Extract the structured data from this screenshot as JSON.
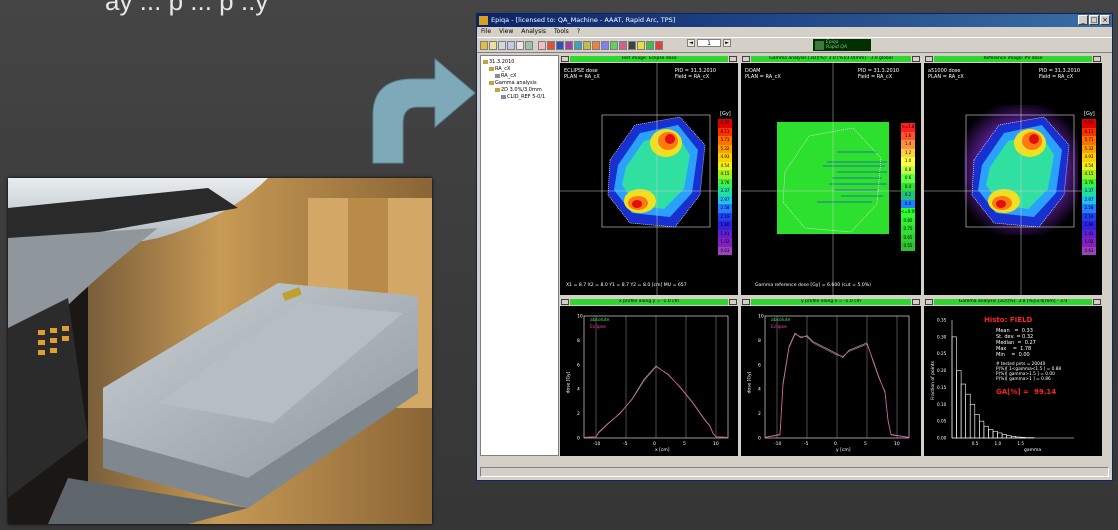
{
  "slide": {
    "caption": "ay  ... p ... p ..y"
  },
  "window": {
    "title": "Epiqa - [licensed to: QA_Machine - AAAT, Rapid Arc, TPS]",
    "menu": [
      "File",
      "View",
      "Analysis",
      "Tools",
      "?"
    ],
    "page_number": "1",
    "logo_line1": "Epiqa",
    "logo_line2": "Rapid QA"
  },
  "tree": {
    "items": [
      {
        "label": "31.3.2010",
        "depth": 0
      },
      {
        "label": "RA_cX",
        "depth": 1
      },
      {
        "label": "RA_cX",
        "depth": 2
      },
      {
        "label": "Gamma analysis",
        "depth": 1
      },
      {
        "label": "2D 3.0%/3.0mm",
        "depth": 2
      },
      {
        "label": "CLID_REF 5-0/1",
        "depth": 3
      }
    ]
  },
  "panels": {
    "test": {
      "title": "Test image: Eclipse dose",
      "left1": "ECLIPSE dose",
      "left2": "PLAN = RA_cX",
      "right1": "PID = 31.3.2010",
      "right2": "Field = RA_cX",
      "footer": "X1 = 8.7  X2 = 8.0  Y1 = 8.7  Y2 = 8.0  [cm]      MU = 657",
      "units": "[Gy]",
      "scale": [
        "6.50",
        "6.11",
        "5.71",
        "5.32",
        "4.93",
        "4.54",
        "4.15",
        "3.76",
        "3.37",
        "2.97",
        "2.58",
        "2.19",
        "1.80",
        "1.41",
        "1.02",
        "0.63"
      ]
    },
    "gamma": {
      "title": "Gamma analysis [3D](%): 3.0 [%]/3.0[mm] - 3.0 global",
      "left1": "DOAM",
      "left2": "PLAN = RA_cX",
      "right1": "PID = 31.3.2010",
      "right2": "Field = RA_cX",
      "footer": "Gamma reference dose [Gy] = 6.600 (cut = 5.0%)",
      "scale": [
        ">=1.8",
        "1.6",
        "1.4",
        "1.2",
        "1.0",
        "0.8",
        "0.6",
        "0.4",
        "0.2",
        "0.0",
        "<=0.95",
        "0.85",
        "0.75",
        "0.65",
        "0.55"
      ]
    },
    "reference": {
      "title": "Reference image: PV dose",
      "left1": "a51000 dose",
      "left2": "PLAN = RA_cX",
      "right1": "PID = 31.3.2010",
      "right2": "Field = RA_cX",
      "units": "[Gy]",
      "scale": [
        "6.50",
        "6.11",
        "5.71",
        "5.32",
        "4.93",
        "4.54",
        "4.15",
        "3.76",
        "3.37",
        "2.97",
        "2.58",
        "2.19",
        "1.80",
        "1.41",
        "1.02",
        "0.63"
      ]
    },
    "xprofile": {
      "title": "x profile along y = -1.0 cm",
      "legend1": "absolute",
      "legend2": "Eclipse",
      "xlabel": "x [cm]",
      "ylabel": "dose [Gy]",
      "xticks": [
        "-10",
        "-5",
        "0",
        "5",
        "10"
      ],
      "yticks": [
        "0",
        "2",
        "4",
        "6",
        "8",
        "10"
      ]
    },
    "yprofile": {
      "title": "y profile along x = -1.0 cm",
      "legend1": "absolute",
      "legend2": "Eclipse",
      "xlabel": "y [cm]",
      "ylabel": "dose [Gy]",
      "xticks": [
        "-10",
        "-5",
        "0",
        "5",
        "10"
      ],
      "yticks": [
        "0",
        "2",
        "4",
        "6",
        "8",
        "10"
      ]
    },
    "histo": {
      "title": "Gamma analysis [2D](%): 3.0 [%]/3.0[mm] - 3.0",
      "heading": "Histo: FIELD",
      "stats": "Mean   =  0.33\nSt. dev. = 0.32\nMedian  =  0.27\nMax    =  1.78\nMin    =  0.00",
      "tested": "# tested pnts = 20040\nP(%)[ 1<gamma<1.5 ] = 0.88\nP(%)[ gamma>1.5 ] = 0.00\nP(%)[ gamma>1 ] = 0.86",
      "ga_label": "GA[%] =",
      "ga_value": "99.14",
      "xlabel": "gamma",
      "ylabel": "Fraction of points",
      "yticks": [
        "0.00",
        "0.05",
        "0.10",
        "0.15",
        "0.20",
        "0.25",
        "0.30",
        "0.35"
      ],
      "xticks": [
        "0.5",
        "1.0",
        "1.5"
      ]
    }
  },
  "colors": {
    "panel_title": "#2fd62f",
    "profile_measured": "#4ce04c",
    "profile_calc": "#ff40c0",
    "ga_text": "#ff2020",
    "arrow": "#7ea9b8"
  },
  "chart_data": [
    {
      "type": "line",
      "title": "x profile along y = -1.0 cm",
      "xlabel": "x [cm]",
      "ylabel": "dose [Gy]",
      "xlim": [
        -12,
        12
      ],
      "ylim": [
        0,
        10
      ],
      "series": [
        {
          "name": "absolute",
          "x": [
            -12,
            -10,
            -9.5,
            -8,
            -6,
            -4,
            -2,
            0,
            2,
            4,
            6,
            8,
            9,
            9.5,
            10,
            12
          ],
          "y": [
            0.05,
            0.1,
            0.5,
            1.2,
            2.0,
            3.2,
            4.8,
            5.9,
            5.2,
            4.2,
            3.0,
            1.6,
            1.0,
            0.4,
            0.1,
            0.05
          ]
        },
        {
          "name": "Eclipse",
          "x": [
            -12,
            -10,
            -9.5,
            -8,
            -6,
            -4,
            -2,
            0,
            2,
            4,
            6,
            8,
            9,
            9.5,
            10,
            12
          ],
          "y": [
            0.05,
            0.1,
            0.45,
            1.15,
            2.05,
            3.15,
            4.7,
            5.85,
            5.25,
            4.15,
            2.95,
            1.55,
            0.95,
            0.35,
            0.1,
            0.05
          ]
        }
      ]
    },
    {
      "type": "line",
      "title": "y profile along x = -1.0 cm",
      "xlabel": "y [cm]",
      "ylabel": "dose [Gy]",
      "xlim": [
        -12,
        12
      ],
      "ylim": [
        0,
        10
      ],
      "series": [
        {
          "name": "absolute",
          "x": [
            -12,
            -9.5,
            -9,
            -8,
            -7,
            -6,
            -5,
            -4,
            -2,
            0,
            1,
            2,
            4,
            5,
            6,
            7,
            8,
            8.5,
            9,
            12
          ],
          "y": [
            0.05,
            0.3,
            4.5,
            7.5,
            8.6,
            8.2,
            8.4,
            7.9,
            7.4,
            6.9,
            6.6,
            7.2,
            7.6,
            7.8,
            6.3,
            4.9,
            3.8,
            1.5,
            0.3,
            0.05
          ]
        },
        {
          "name": "Eclipse",
          "x": [
            -12,
            -9.5,
            -9,
            -8,
            -7,
            -6,
            -5,
            -4,
            -2,
            0,
            1,
            2,
            4,
            5,
            6,
            7,
            8,
            8.5,
            9,
            12
          ],
          "y": [
            0.05,
            0.25,
            4.3,
            7.4,
            8.5,
            8.3,
            8.3,
            7.8,
            7.3,
            6.8,
            6.7,
            7.1,
            7.5,
            7.7,
            6.4,
            5.0,
            3.7,
            1.4,
            0.25,
            0.05
          ]
        }
      ]
    },
    {
      "type": "bar",
      "title": "Histo: FIELD",
      "xlabel": "gamma",
      "ylabel": "Fraction of points",
      "xlim": [
        0,
        1.8
      ],
      "ylim": [
        0,
        0.35
      ],
      "x": [
        0.0,
        0.1,
        0.2,
        0.3,
        0.4,
        0.5,
        0.6,
        0.7,
        0.8,
        0.9,
        1.0,
        1.1,
        1.2,
        1.3,
        1.4,
        1.5,
        1.6,
        1.7
      ],
      "values": [
        0.3,
        0.2,
        0.16,
        0.13,
        0.1,
        0.07,
        0.05,
        0.035,
        0.025,
        0.02,
        0.015,
        0.01,
        0.007,
        0.005,
        0.003,
        0.002,
        0.001,
        0.001
      ]
    }
  ]
}
